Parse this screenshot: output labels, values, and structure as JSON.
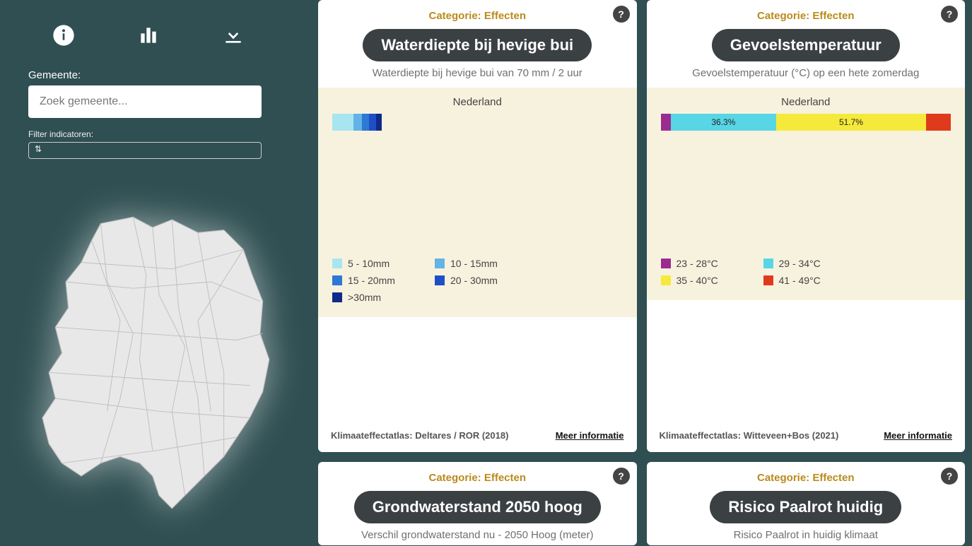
{
  "sidebar": {
    "gemeente_label": "Gemeente:",
    "search_placeholder": "Zoek gemeente...",
    "filter_label": "Filter indicatoren:"
  },
  "colors": {
    "waterdiepte": [
      "#a7e6f0",
      "#63b3e6",
      "#2e78d6",
      "#1f4fc4",
      "#102a8a"
    ],
    "gevoelstemp": [
      "#9b2b8f",
      "#58d6e6",
      "#f5ea3b",
      "#e03a1c"
    ]
  },
  "cards": [
    {
      "category": "Categorie: Effecten",
      "title": "Waterdiepte bij hevige bui",
      "subtitle": "Waterdiepte bij hevige bui van 70 mm / 2 uur",
      "region_label": "Nederland",
      "source": "Klimaateffectatlas: Deltares / ROR (2018)",
      "more": "Meer informatie",
      "legend": [
        {
          "c": "#a7e6f0",
          "t": "5 - 10mm"
        },
        {
          "c": "#63b3e6",
          "t": "10 - 15mm"
        },
        {
          "c": "#2e78d6",
          "t": "15 - 20mm"
        },
        {
          "c": "#1f4fc4",
          "t": "20 - 30mm"
        },
        {
          "c": "#102a8a",
          "t": ">30mm"
        }
      ]
    },
    {
      "category": "Categorie: Effecten",
      "title": "Gevoelstemperatuur",
      "subtitle": "Gevoelstemperatuur (°C) op een hete zomerdag",
      "region_label": "Nederland",
      "source": "Klimaateffectatlas: Witteveen+Bos (2021)",
      "more": "Meer informatie",
      "legend": [
        {
          "c": "#9b2b8f",
          "t": "23 - 28°C"
        },
        {
          "c": "#58d6e6",
          "t": "29 - 34°C"
        },
        {
          "c": "#f5ea3b",
          "t": "35 - 40°C"
        },
        {
          "c": "#e03a1c",
          "t": "41 - 49°C"
        }
      ]
    },
    {
      "category": "Categorie: Effecten",
      "title": "Grondwaterstand 2050 hoog",
      "subtitle": "Verschil grondwaterstand nu - 2050 Hoog (meter)"
    },
    {
      "category": "Categorie: Effecten",
      "title": "Risico Paalrot huidig",
      "subtitle": "Risico Paalrot in huidig klimaat"
    }
  ],
  "chart_data": [
    {
      "type": "bar",
      "title": "Waterdiepte bij hevige bui — Nederland",
      "categories": [
        "5-10mm",
        "10-15mm",
        "15-20mm",
        "20-30mm",
        ">30mm"
      ],
      "values_note": "swatch only, no numeric labels visible",
      "colors": [
        "#a7e6f0",
        "#63b3e6",
        "#2e78d6",
        "#1f4fc4",
        "#102a8a"
      ]
    },
    {
      "type": "bar",
      "title": "Gevoelstemperatuur — Nederland",
      "categories": [
        "23-28°C",
        "29-34°C",
        "35-40°C",
        "41-49°C"
      ],
      "series": [
        {
          "name": "Nederland",
          "values": [
            3.5,
            36.3,
            51.7,
            8.5
          ]
        }
      ],
      "labels_shown": [
        "",
        "36.3%",
        "51.7%",
        ""
      ],
      "colors": [
        "#9b2b8f",
        "#58d6e6",
        "#f5ea3b",
        "#e03a1c"
      ]
    }
  ]
}
